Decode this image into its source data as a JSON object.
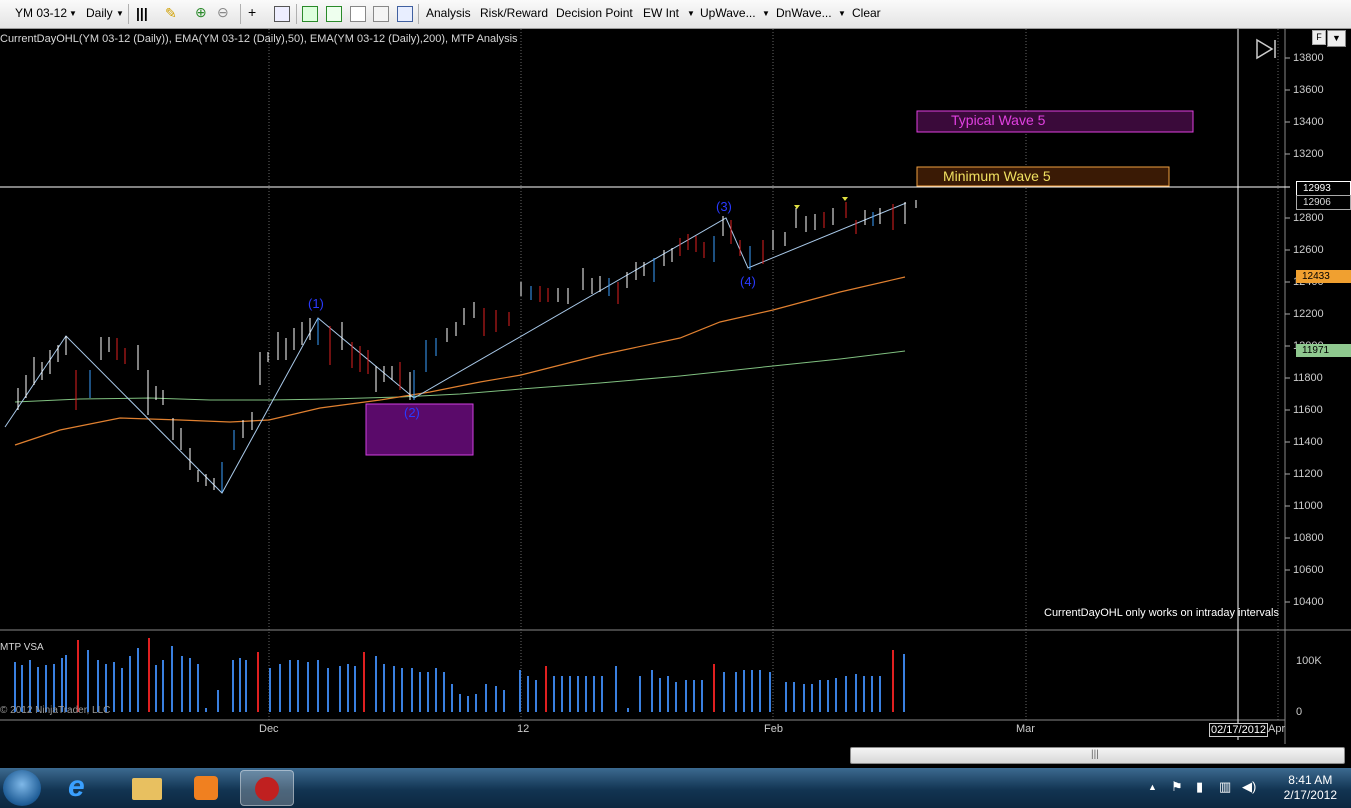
{
  "toolbar": {
    "instrument": "YM 03-12",
    "period": "Daily",
    "menus": [
      "Analysis",
      "Risk/Reward",
      "Decision Point",
      "EW Int",
      "UpWave...",
      "DnWave...",
      "Clear"
    ]
  },
  "chart": {
    "caption": "CurrentDayOHL(YM 03-12 (Daily)), EMA(YM 03-12 (Daily),50), EMA(YM 03-12 (Daily),200), MTP Analysis",
    "zones": {
      "typical": "Typical Wave 5",
      "minimum": "Minimum Wave 5"
    },
    "waves": [
      "(1)",
      "(2)",
      "(3)",
      "(4)"
    ],
    "price_axis": [
      "13800",
      "13600",
      "13400",
      "13200",
      "12800",
      "12600",
      "12400",
      "12200",
      "12000",
      "11800",
      "11600",
      "11400",
      "11200",
      "11000",
      "10800",
      "10600",
      "10400"
    ],
    "price_boxes": {
      "line": "12993",
      "last": "12906",
      "ema50": "12433",
      "ema200": "11971"
    },
    "note": "CurrentDayOHL only works on intraday intervals",
    "vsa_label": "MTP VSA",
    "volume_axis": [
      "100K",
      "0"
    ],
    "copyright": "© 2012 NinjaTrader, LLC",
    "date_axis": [
      "Dec",
      "12",
      "Feb",
      "Mar",
      "Apr"
    ],
    "date_box": "02/17/2012",
    "colors": {
      "up_bar": "#ffffff",
      "down_bar": "#e02020",
      "blue_bar": "#3aa0ff",
      "ema50": "#e08030",
      "ema200": "#80c080",
      "wave_line": "#a8c8e8",
      "typical_zone": "#e040e0",
      "minimum_zone": "#f0a040"
    }
  },
  "taskbar": {
    "time": "8:41 AM",
    "date": "2/17/2012"
  }
}
